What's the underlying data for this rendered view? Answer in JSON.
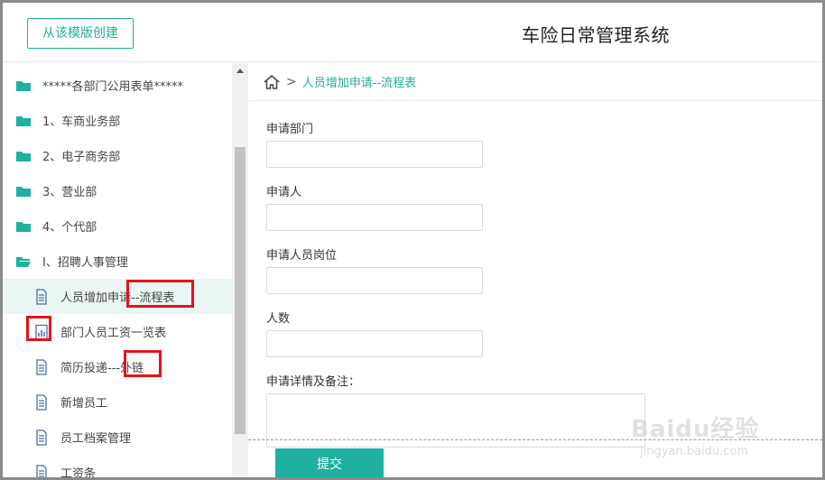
{
  "header": {
    "template_button": "从该模版创建",
    "app_title": "车险日常管理系统"
  },
  "sidebar": {
    "items": [
      {
        "label": "*****各部门公用表单*****",
        "icon": "folder-icon"
      },
      {
        "label": "1、车商业务部",
        "icon": "folder-icon"
      },
      {
        "label": "2、电子商务部",
        "icon": "folder-icon"
      },
      {
        "label": "3、营业部",
        "icon": "folder-icon"
      },
      {
        "label": "4、个代部",
        "icon": "folder-icon"
      },
      {
        "label": "Ⅰ、招聘人事管理",
        "icon": "folder-open-icon"
      },
      {
        "label": "人员增加申请--流程表",
        "icon": "document-icon"
      },
      {
        "label": "部门人员工资一览表",
        "icon": "report-icon"
      },
      {
        "label": "简历投递---外链",
        "icon": "document-icon"
      },
      {
        "label": "新增员工",
        "icon": "document-icon"
      },
      {
        "label": "员工档案管理",
        "icon": "document-icon"
      },
      {
        "label": "工资条",
        "icon": "document-icon"
      }
    ]
  },
  "breadcrumb": {
    "separator": ">",
    "current": "人员增加申请--流程表"
  },
  "form": {
    "fields": [
      {
        "label": "申请部门",
        "value": ""
      },
      {
        "label": "申请人",
        "value": ""
      },
      {
        "label": "申请人员岗位",
        "value": ""
      },
      {
        "label": "人数",
        "value": ""
      }
    ],
    "notes_label": "申请详情及备注：",
    "notes_value": "",
    "submit_label": "提交"
  },
  "watermark": {
    "text": "Baidu经验",
    "sub": "jingyan.baidu.com"
  },
  "colors": {
    "accent": "#27a99c",
    "submit": "#1fb0a0",
    "highlight": "#e0141e"
  }
}
